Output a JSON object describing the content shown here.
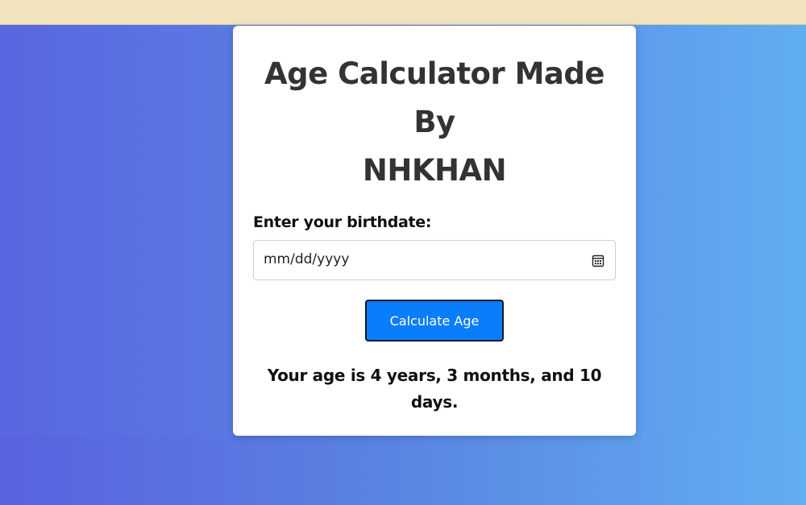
{
  "page": {
    "title_lines": [
      "Age Calculator Made",
      "By",
      "NHKHAN"
    ]
  },
  "form": {
    "label": "Enter your birthdate:",
    "date_placeholder": "mm/dd/yyyy",
    "button_label": "Calculate Age"
  },
  "result": {
    "text": "Your age is 4 years, 3 months, and 10 days."
  },
  "icons": {
    "date_picker": "calendar-icon"
  },
  "colors": {
    "top_strip": "#f1e3be",
    "gradient_start": "#5967e0",
    "gradient_end": "#60aef1",
    "button": "#0a7dfa",
    "title_text": "#333333"
  }
}
